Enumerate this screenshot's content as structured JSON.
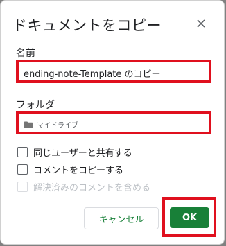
{
  "dialog": {
    "title": "ドキュメントをコピー",
    "close_icon": "close-icon"
  },
  "name_field": {
    "label": "名前",
    "value": "ending-note-Template のコピー"
  },
  "folder_field": {
    "label": "フォルダ",
    "icon": "folder-icon",
    "value": "マイドライブ"
  },
  "options": [
    {
      "label": "同じユーザーと共有する",
      "checked": false,
      "disabled": false
    },
    {
      "label": "コメントをコピーする",
      "checked": false,
      "disabled": false
    },
    {
      "label": "解決済みのコメントを含める",
      "checked": false,
      "disabled": true
    }
  ],
  "buttons": {
    "cancel_label": "キャンセル",
    "ok_label": "OK"
  },
  "colors": {
    "accent_green": "#188038",
    "highlight_red": "#e0101e"
  }
}
